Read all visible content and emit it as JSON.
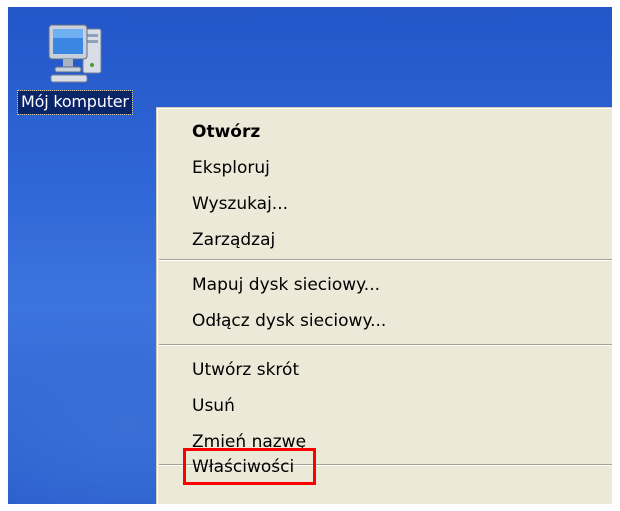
{
  "desktop": {
    "icon": {
      "label": "Mój komputer",
      "glyph": "my-computer-icon"
    }
  },
  "context_menu": {
    "groups": [
      {
        "items": [
          {
            "label": "Otwórz",
            "default": true
          },
          {
            "label": "Eksploruj"
          },
          {
            "label": "Wyszukaj..."
          },
          {
            "label": "Zarządzaj"
          }
        ]
      },
      {
        "items": [
          {
            "label": "Mapuj dysk sieciowy..."
          },
          {
            "label": "Odłącz dysk sieciowy..."
          }
        ]
      },
      {
        "items": [
          {
            "label": "Utwórz skrót"
          },
          {
            "label": "Usuń"
          },
          {
            "label": "Zmień nazwę"
          }
        ]
      },
      {
        "items": [
          {
            "label": "Właściwości",
            "highlighted": true
          }
        ]
      }
    ]
  },
  "colors": {
    "desktop_blue": "#2f66d6",
    "menu_background": "#ece9d8",
    "selection_label_bg": "#0a246a",
    "highlight_outline": "#ff0000"
  }
}
